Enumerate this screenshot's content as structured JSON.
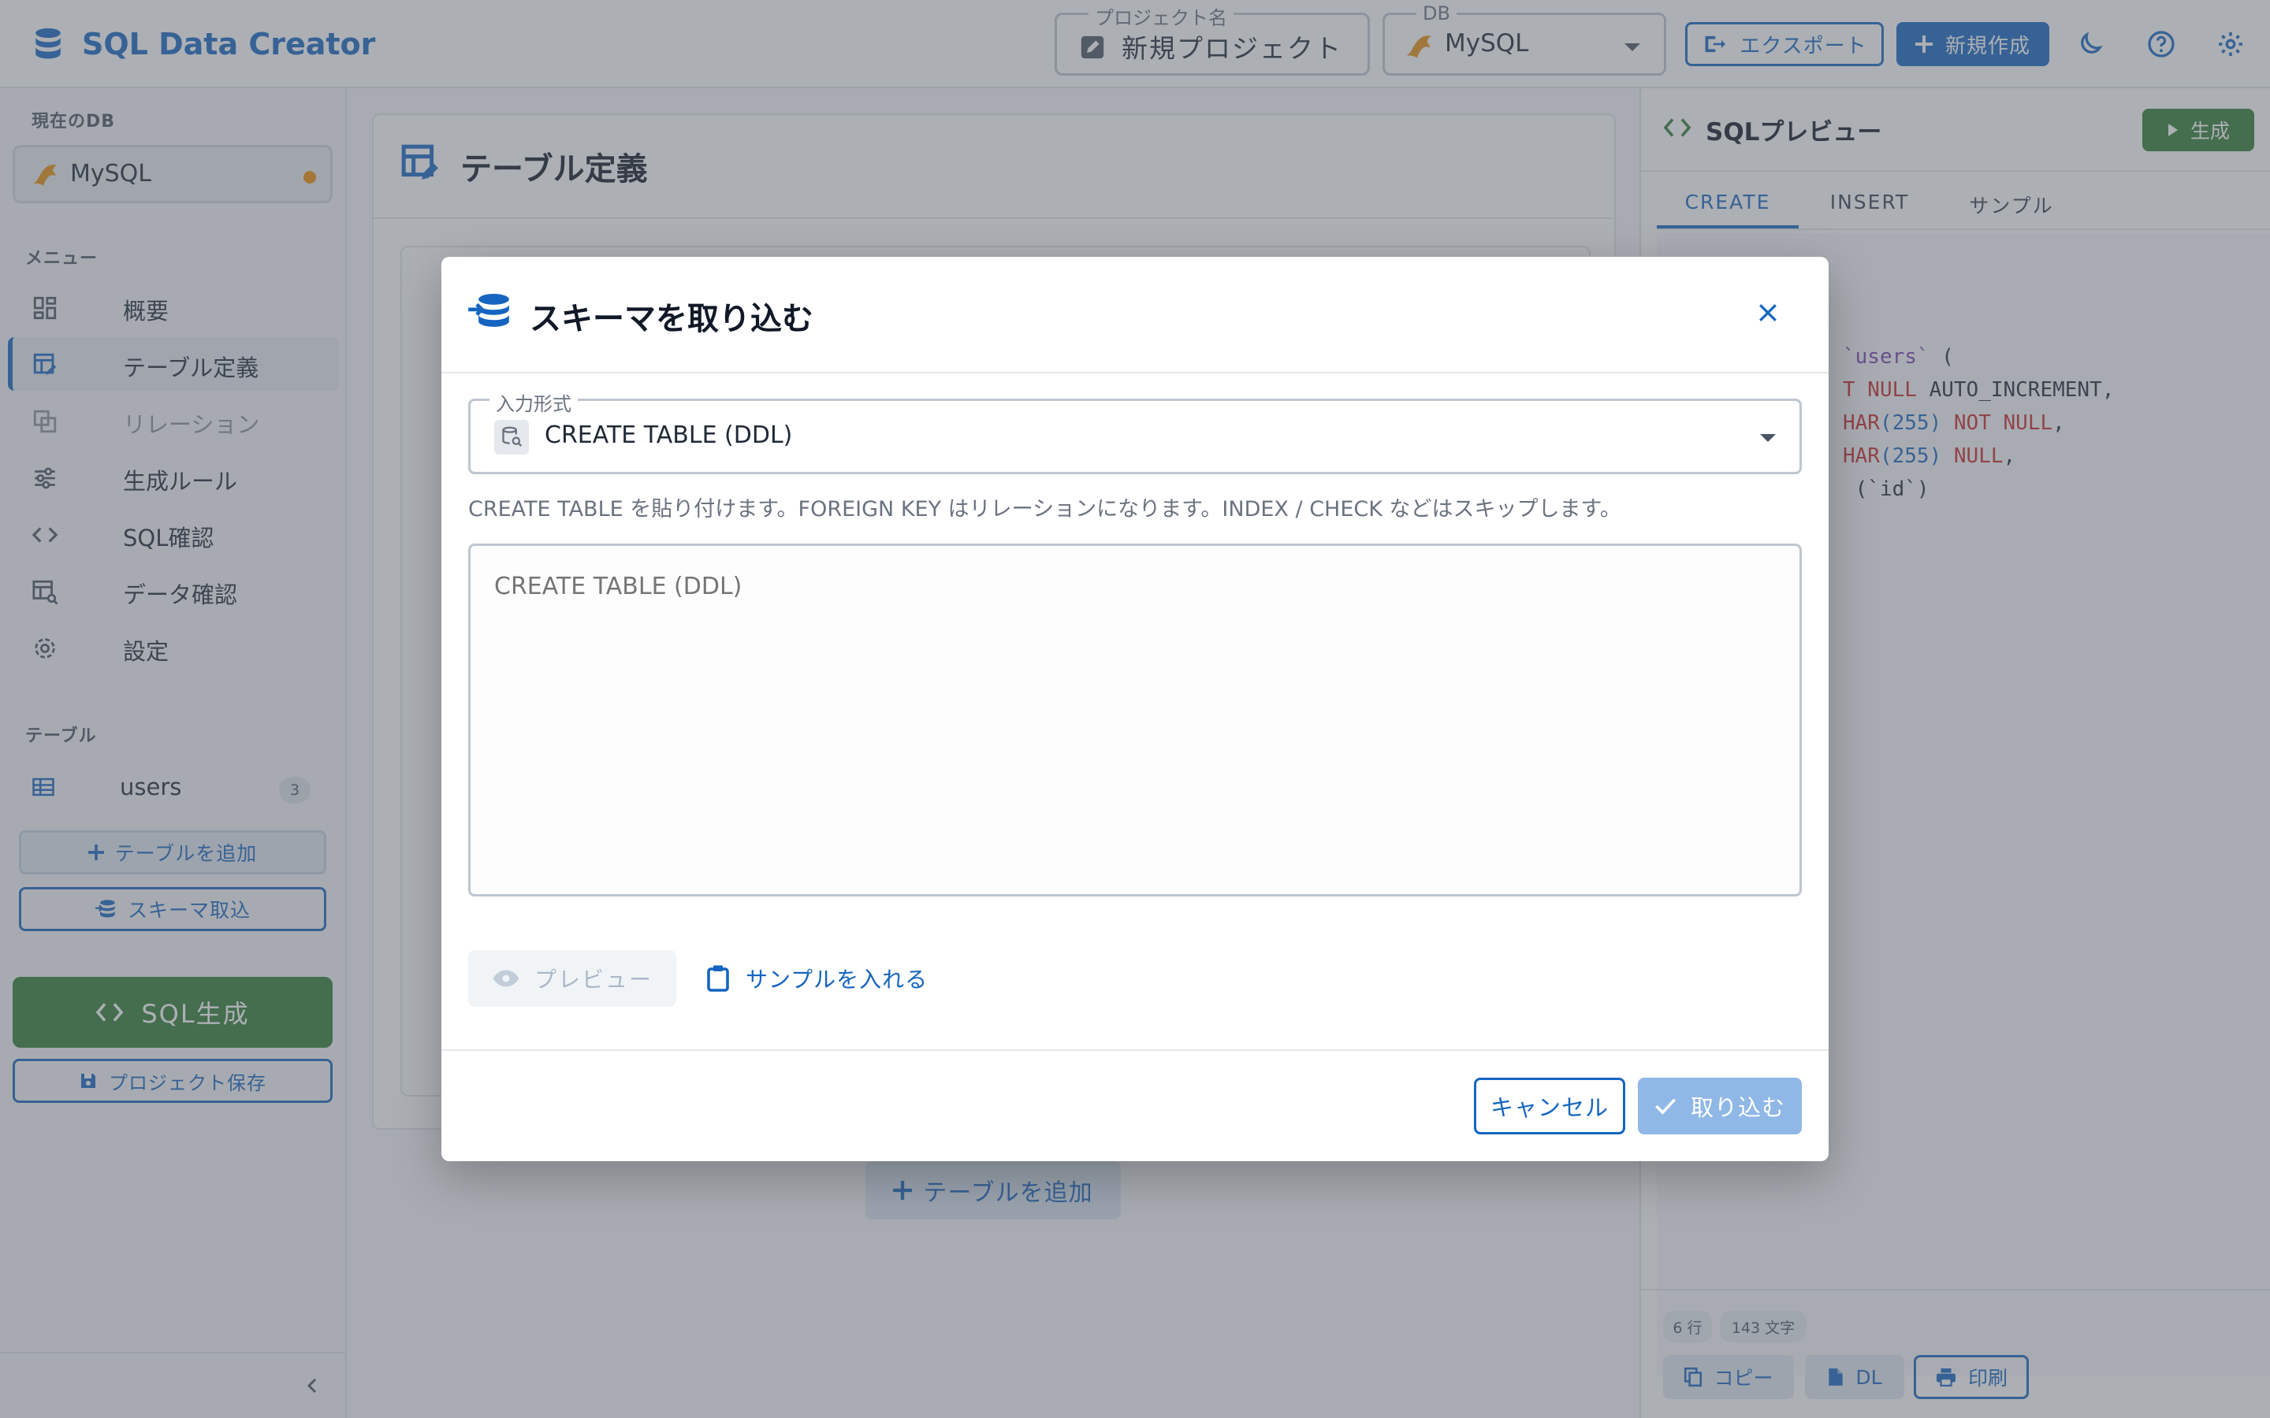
{
  "header": {
    "app_title": "SQL Data Creator",
    "project_legend": "プロジェクト名",
    "project_name": "新規プロジェクト",
    "db_legend": "DB",
    "db_value": "MySQL",
    "export_label": "エクスポート",
    "new_label": "新規作成"
  },
  "sidebar": {
    "current_db_title": "現在のDB",
    "current_db": "MySQL",
    "menu_title": "メニュー",
    "menu": [
      {
        "label": "概要"
      },
      {
        "label": "テーブル定義"
      },
      {
        "label": "リレーション"
      },
      {
        "label": "生成ルール"
      },
      {
        "label": "SQL確認"
      },
      {
        "label": "データ確認"
      },
      {
        "label": "設定"
      }
    ],
    "tables_title": "テーブル",
    "tables": [
      {
        "name": "users",
        "count": "3"
      }
    ],
    "add_table": "テーブルを追加",
    "import_schema": "スキーマ取込",
    "generate_sql": "SQL生成",
    "save_project": "プロジェクト保存"
  },
  "main": {
    "title": "テーブル定義",
    "add_table": "テーブルを追加"
  },
  "preview": {
    "title": "SQLプレビュー",
    "generate": "生成",
    "tabs": [
      "CREATE",
      "INSERT",
      "サンプル"
    ],
    "code": {
      "l1_ident": "`users`",
      "l1_rest": " (",
      "l2_kw": "T NULL",
      "l2_rest": " AUTO_INCREMENT,",
      "l3_type": "HAR",
      "l3_num": "(255)",
      "l3_kw": " NOT NULL",
      "l3_rest": ",",
      "l4_type": "HAR",
      "l4_num": "(255)",
      "l4_kw": " NULL",
      "l4_rest": ",",
      "l5": " (`id`)"
    },
    "rows_chip": "6 行",
    "chars_chip": "143 文字",
    "copy": "コピー",
    "download": "DL",
    "print": "印刷"
  },
  "modal": {
    "title": "スキーマを取り込む",
    "format_legend": "入力形式",
    "format_value": "CREATE TABLE (DDL)",
    "hint": "CREATE TABLE を貼り付けます。FOREIGN KEY はリレーションになります。INDEX / CHECK などはスキップします。",
    "textarea_placeholder": "CREATE TABLE (DDL)",
    "preview_label": "プレビュー",
    "sample_label": "サンプルを入れる",
    "cancel_label": "キャンセル",
    "import_label": "取り込む"
  },
  "colors": {
    "primary": "#1565c0",
    "success": "#2e7d32",
    "accent_orange": "#f08c00"
  }
}
